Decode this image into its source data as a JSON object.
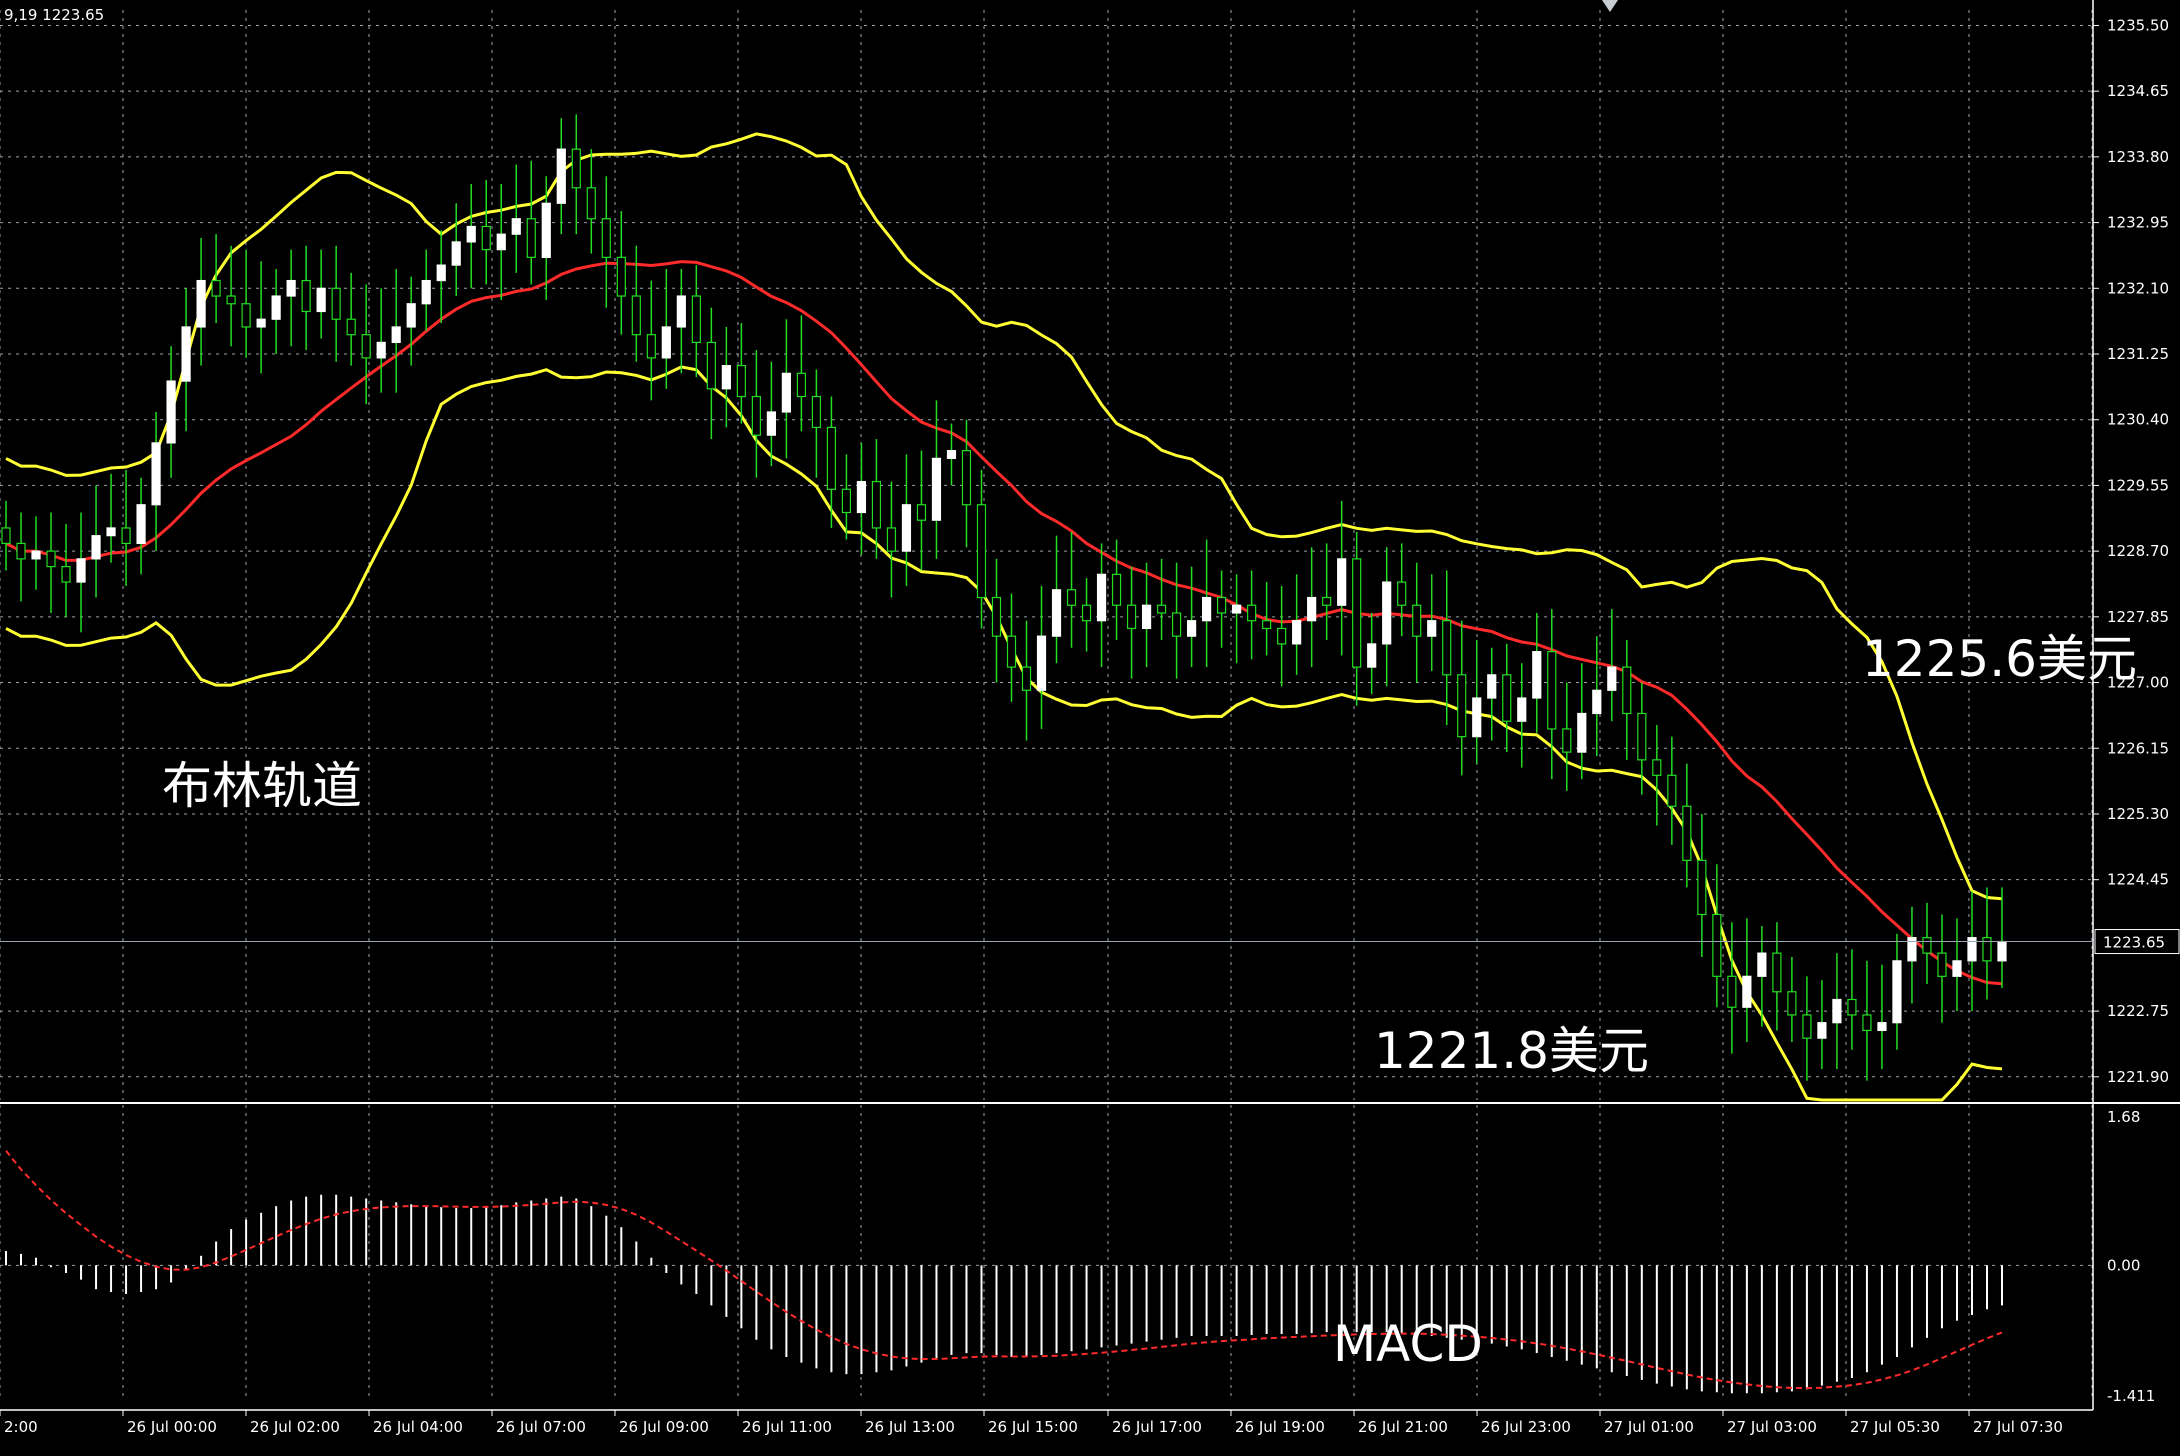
{
  "header": {
    "symbol_info": "9,19 1223.65"
  },
  "colors": {
    "background": "#000000",
    "grid": "#9ba3ad",
    "bull_candle": "#ffffff",
    "wick": "#22dd22",
    "bollinger": "#ffff33",
    "middle_band": "#ff2a2a",
    "macd_hist": "#ffffff",
    "macd_signal": "#ff2a2a",
    "price_line": "#9aa4b0"
  },
  "price_axis": {
    "ticks": [
      "1235.50",
      "1234.65",
      "1233.80",
      "1232.95",
      "1232.10",
      "1231.25",
      "1230.40",
      "1229.55",
      "1228.70",
      "1227.85",
      "1227.00",
      "1226.15",
      "1225.30",
      "1224.45",
      "1222.75",
      "1221.90"
    ],
    "current_price": "1223.65"
  },
  "macd_axis": {
    "ticks": [
      "1.68",
      "0.00",
      "-1.411"
    ]
  },
  "time_axis": {
    "labels": [
      "2:00",
      "26 Jul 00:00",
      "26 Jul 02:00",
      "26 Jul 04:00",
      "26 Jul 07:00",
      "26 Jul 09:00",
      "26 Jul 11:00",
      "26 Jul 13:00",
      "26 Jul 15:00",
      "26 Jul 17:00",
      "26 Jul 19:00",
      "26 Jul 21:00",
      "26 Jul 23:00",
      "27 Jul 01:00",
      "27 Jul 03:00",
      "27 Jul 05:30",
      "27 Jul 07:30"
    ]
  },
  "annotations": {
    "bollinger_label": "布林轨道",
    "upper_price": "1225.6美元",
    "lower_price": "1221.8美元",
    "macd_label": "MACD"
  },
  "chart_data": {
    "type": "candlestick",
    "indicators": [
      "Bollinger Bands",
      "MACD"
    ],
    "price_ylim": [
      1221.6,
      1235.7
    ],
    "macd_ylim": [
      -1.411,
      1.68
    ],
    "closes": [
      1228.8,
      1228.6,
      1228.7,
      1228.5,
      1228.3,
      1228.6,
      1228.9,
      1229.0,
      1228.8,
      1229.3,
      1230.1,
      1230.9,
      1231.6,
      1232.2,
      1232.0,
      1231.9,
      1231.6,
      1231.7,
      1232.0,
      1232.2,
      1231.8,
      1232.1,
      1231.7,
      1231.5,
      1231.2,
      1231.4,
      1231.6,
      1231.9,
      1232.2,
      1232.4,
      1232.7,
      1232.9,
      1232.6,
      1232.8,
      1233.0,
      1232.5,
      1233.2,
      1233.9,
      1233.4,
      1233.0,
      1232.5,
      1232.0,
      1231.5,
      1231.2,
      1231.6,
      1232.0,
      1231.4,
      1230.8,
      1231.1,
      1230.7,
      1230.2,
      1230.5,
      1231.0,
      1230.7,
      1230.3,
      1229.5,
      1229.2,
      1229.6,
      1229.0,
      1228.7,
      1229.3,
      1229.1,
      1229.9,
      1230.0,
      1229.3,
      1228.1,
      1227.6,
      1227.2,
      1226.9,
      1227.6,
      1228.2,
      1228.0,
      1227.8,
      1228.4,
      1228.0,
      1227.7,
      1228.0,
      1227.9,
      1227.6,
      1227.8,
      1228.1,
      1227.9,
      1228.0,
      1227.8,
      1227.7,
      1227.5,
      1227.8,
      1228.1,
      1228.0,
      1228.6,
      1227.2,
      1227.5,
      1228.3,
      1228.0,
      1227.6,
      1227.8,
      1227.1,
      1226.3,
      1226.8,
      1227.1,
      1226.5,
      1226.8,
      1227.4,
      1226.4,
      1226.1,
      1226.6,
      1226.9,
      1227.2,
      1226.6,
      1226.0,
      1225.8,
      1225.4,
      1224.7,
      1224.0,
      1223.2,
      1222.8,
      1223.2,
      1223.5,
      1223.0,
      1222.7,
      1222.4,
      1222.6,
      1222.9,
      1222.7,
      1222.5,
      1222.6,
      1223.4,
      1223.7,
      1223.5,
      1223.2,
      1223.4,
      1223.7,
      1223.4,
      1223.65
    ],
    "macd_histogram": [
      0.15,
      0.12,
      0.08,
      -0.02,
      -0.08,
      -0.15,
      -0.25,
      -0.28,
      -0.3,
      -0.28,
      -0.25,
      -0.18,
      -0.05,
      0.1,
      0.25,
      0.38,
      0.48,
      0.55,
      0.62,
      0.68,
      0.72,
      0.74,
      0.74,
      0.72,
      0.7,
      0.68,
      0.66,
      0.64,
      0.62,
      0.61,
      0.6,
      0.6,
      0.61,
      0.63,
      0.66,
      0.68,
      0.7,
      0.72,
      0.7,
      0.62,
      0.52,
      0.4,
      0.25,
      0.08,
      -0.08,
      -0.2,
      -0.3,
      -0.42,
      -0.54,
      -0.66,
      -0.78,
      -0.88,
      -0.96,
      -1.02,
      -1.08,
      -1.12,
      -1.14,
      -1.14,
      -1.12,
      -1.1,
      -1.06,
      -1.02,
      -0.98,
      -0.94,
      -0.92,
      -0.92,
      -0.94,
      -0.96,
      -0.96,
      -0.94,
      -0.92,
      -0.9,
      -0.88,
      -0.86,
      -0.84,
      -0.82,
      -0.8,
      -0.78,
      -0.76,
      -0.74,
      -0.74,
      -0.74,
      -0.74,
      -0.73,
      -0.72,
      -0.72,
      -0.72,
      -0.71,
      -0.7,
      -0.7,
      -0.7,
      -0.7,
      -0.7,
      -0.71,
      -0.72,
      -0.74,
      -0.76,
      -0.78,
      -0.8,
      -0.82,
      -0.85,
      -0.88,
      -0.92,
      -0.96,
      -1.0,
      -1.04,
      -1.08,
      -1.12,
      -1.16,
      -1.2,
      -1.24,
      -1.27,
      -1.3,
      -1.32,
      -1.33,
      -1.34,
      -1.34,
      -1.34,
      -1.33,
      -1.32,
      -1.3,
      -1.26,
      -1.22,
      -1.18,
      -1.12,
      -1.04,
      -0.96,
      -0.86,
      -0.76,
      -0.66,
      -0.58,
      -0.52,
      -0.46,
      -0.42
    ]
  }
}
